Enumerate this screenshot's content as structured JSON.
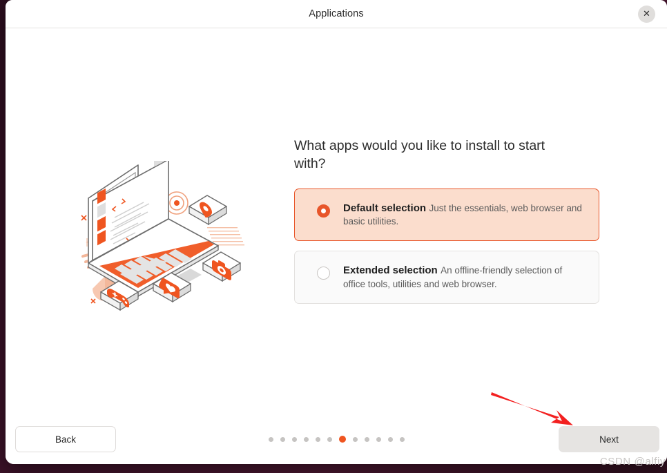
{
  "window": {
    "title": "Applications",
    "close_label": "✕"
  },
  "main": {
    "heading": "What apps would you like to install to start with?",
    "options": [
      {
        "id": "default-selection",
        "title": "Default selection",
        "description": "Just the essentials, web browser and basic utilities.",
        "selected": true
      },
      {
        "id": "extended-selection",
        "title": "Extended selection",
        "description": "An offline-friendly selection of office tools, utilities and web browser.",
        "selected": false
      }
    ]
  },
  "illustration": {
    "name": "isometric-laptop-with-app-tiles",
    "tiles": [
      "map-pin-tile",
      "camera-tile",
      "gamepad-tile",
      "heart-chat-tile"
    ]
  },
  "footer": {
    "back_label": "Back",
    "next_label": "Next",
    "pagination": {
      "total": 12,
      "current": 7
    }
  },
  "annotation": {
    "arrow_target": "next-button",
    "arrow_color": "#f32020"
  },
  "watermark": {
    "text": "CSDN @alfiy"
  },
  "colors": {
    "accent": "#e8562a",
    "accent_dot": "#ef5520",
    "selected_card_bg": "#fbddcd",
    "unselected_card_bg": "#fafafa",
    "desktop_bg": "#3b1228",
    "window_bg": "#ffffff"
  }
}
